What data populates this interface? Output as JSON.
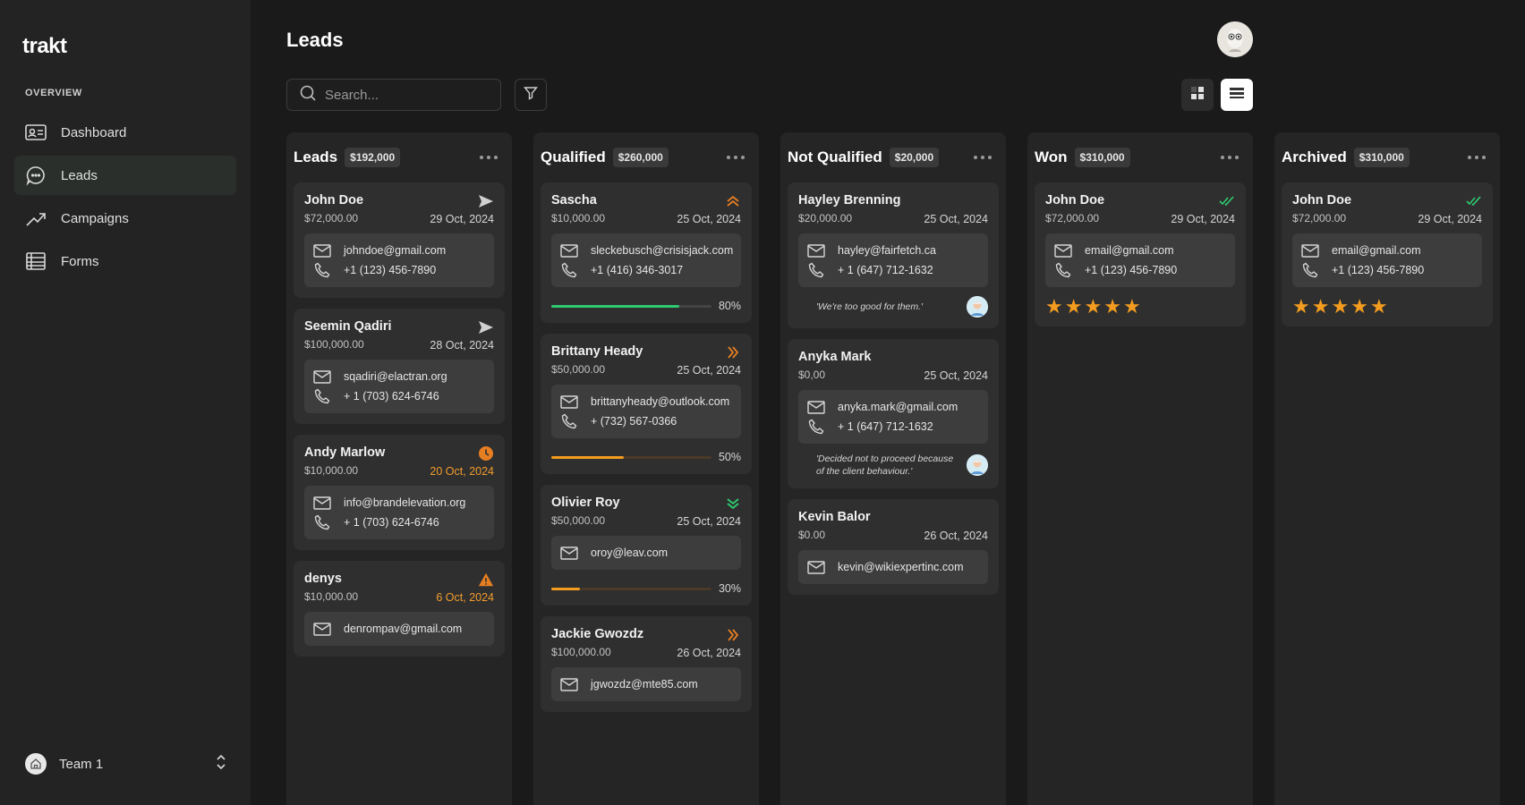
{
  "app": {
    "logo": "trakt"
  },
  "sidebar": {
    "section": "OVERVIEW",
    "items": [
      {
        "label": "Dashboard",
        "icon": "id-card-icon"
      },
      {
        "label": "Leads",
        "icon": "chat-icon",
        "active": true
      },
      {
        "label": "Campaigns",
        "icon": "trend-icon"
      },
      {
        "label": "Forms",
        "icon": "table-icon"
      }
    ],
    "team": "Team 1"
  },
  "header": {
    "title": "Leads",
    "search_placeholder": "Search..."
  },
  "columns": [
    {
      "title": "Leads",
      "total": "$192,000",
      "cards": [
        {
          "name": "John Doe",
          "amount": "$72,000.00",
          "date": "29 Oct, 2024",
          "email": "johndoe@gmail.com",
          "phone": "+1 (123) 456-7890",
          "icon": "send-icon"
        },
        {
          "name": "Seemin Qadiri",
          "amount": "$100,000.00",
          "date": "28 Oct, 2024",
          "email": "sqadiri@elactran.org",
          "phone": "+ 1 (703) 624-6746",
          "icon": "send-icon"
        },
        {
          "name": "Andy Marlow",
          "amount": "$10,000.00",
          "date": "20 Oct, 2024",
          "email": "info@brandelevation.org",
          "phone": "+ 1 (703) 624-6746",
          "icon": "clock-icon"
        },
        {
          "name": "denys",
          "amount": "$10,000.00",
          "date": "6 Oct, 2024",
          "email": "denrompav@gmail.com",
          "icon": "warning-icon"
        }
      ]
    },
    {
      "title": "Qualified",
      "total": "$260,000",
      "cards": [
        {
          "name": "Sascha",
          "amount": "$10,000.00",
          "date": "25 Oct, 2024",
          "email": "sleckebusch@crisisjack.com",
          "phone": "+1 (416) 346-3017",
          "progress": 80,
          "progress_label": "80%",
          "icon": "chevron-up-double-icon"
        },
        {
          "name": "Brittany Heady",
          "amount": "$50,000.00",
          "date": "25 Oct, 2024",
          "email": "brittanyheady@outlook.com",
          "phone": "+ (732) 567-0366",
          "progress": 50,
          "progress_label": "50%",
          "icon": "chevron-right-double-icon"
        },
        {
          "name": "Olivier Roy",
          "amount": "$50,000.00",
          "date": "25 Oct, 2024",
          "email": "oroy@leav.com",
          "progress": 30,
          "progress_label": "30%",
          "icon": "chevron-down-double-icon"
        },
        {
          "name": "Jackie Gwozdz",
          "amount": "$100,000.00",
          "date": "26 Oct, 2024",
          "email": "jgwozdz@mte85.com",
          "icon": "chevron-right-double-icon"
        }
      ]
    },
    {
      "title": "Not Qualified",
      "total": "$20,000",
      "cards": [
        {
          "name": "Hayley Brenning",
          "amount": "$20,000.00",
          "date": "25 Oct, 2024",
          "email": "hayley@fairfetch.ca",
          "phone": "+ 1 (647) 712-1632",
          "note": "'We're too good for them.'"
        },
        {
          "name": "Anyka Mark",
          "amount": "$0,00",
          "date": "25 Oct, 2024",
          "email": "anyka.mark@gmail.com",
          "phone": "+ 1 (647) 712-1632",
          "note": "'Decided not to proceed because of the client behaviour.'"
        },
        {
          "name": "Kevin Balor",
          "amount": "$0.00",
          "date": "26 Oct, 2024",
          "email": "kevin@wikiexpertinc.com"
        }
      ]
    },
    {
      "title": "Won",
      "total": "$310,000",
      "cards": [
        {
          "name": "John Doe",
          "amount": "$72,000.00",
          "date": "29 Oct, 2024",
          "email": "email@gmail.com",
          "phone": "+1 (123) 456-7890",
          "rating": 5,
          "icon": "double-check-icon"
        }
      ]
    },
    {
      "title": "Archived",
      "total": "$310,000",
      "cards": [
        {
          "name": "John Doe",
          "amount": "$72,000.00",
          "date": "29 Oct, 2024",
          "email": "email@gmail.com",
          "phone": "+1 (123) 456-7890",
          "rating": 5,
          "icon": "double-check-icon"
        }
      ]
    }
  ],
  "colors": {
    "background": "#1a1a1a",
    "sidebar": "#232323",
    "column": "#252525",
    "card": "#2f2f2f",
    "contact": "#3d3d3d",
    "accent_orange": "#f39c1f",
    "success_green": "#2ecc71"
  }
}
